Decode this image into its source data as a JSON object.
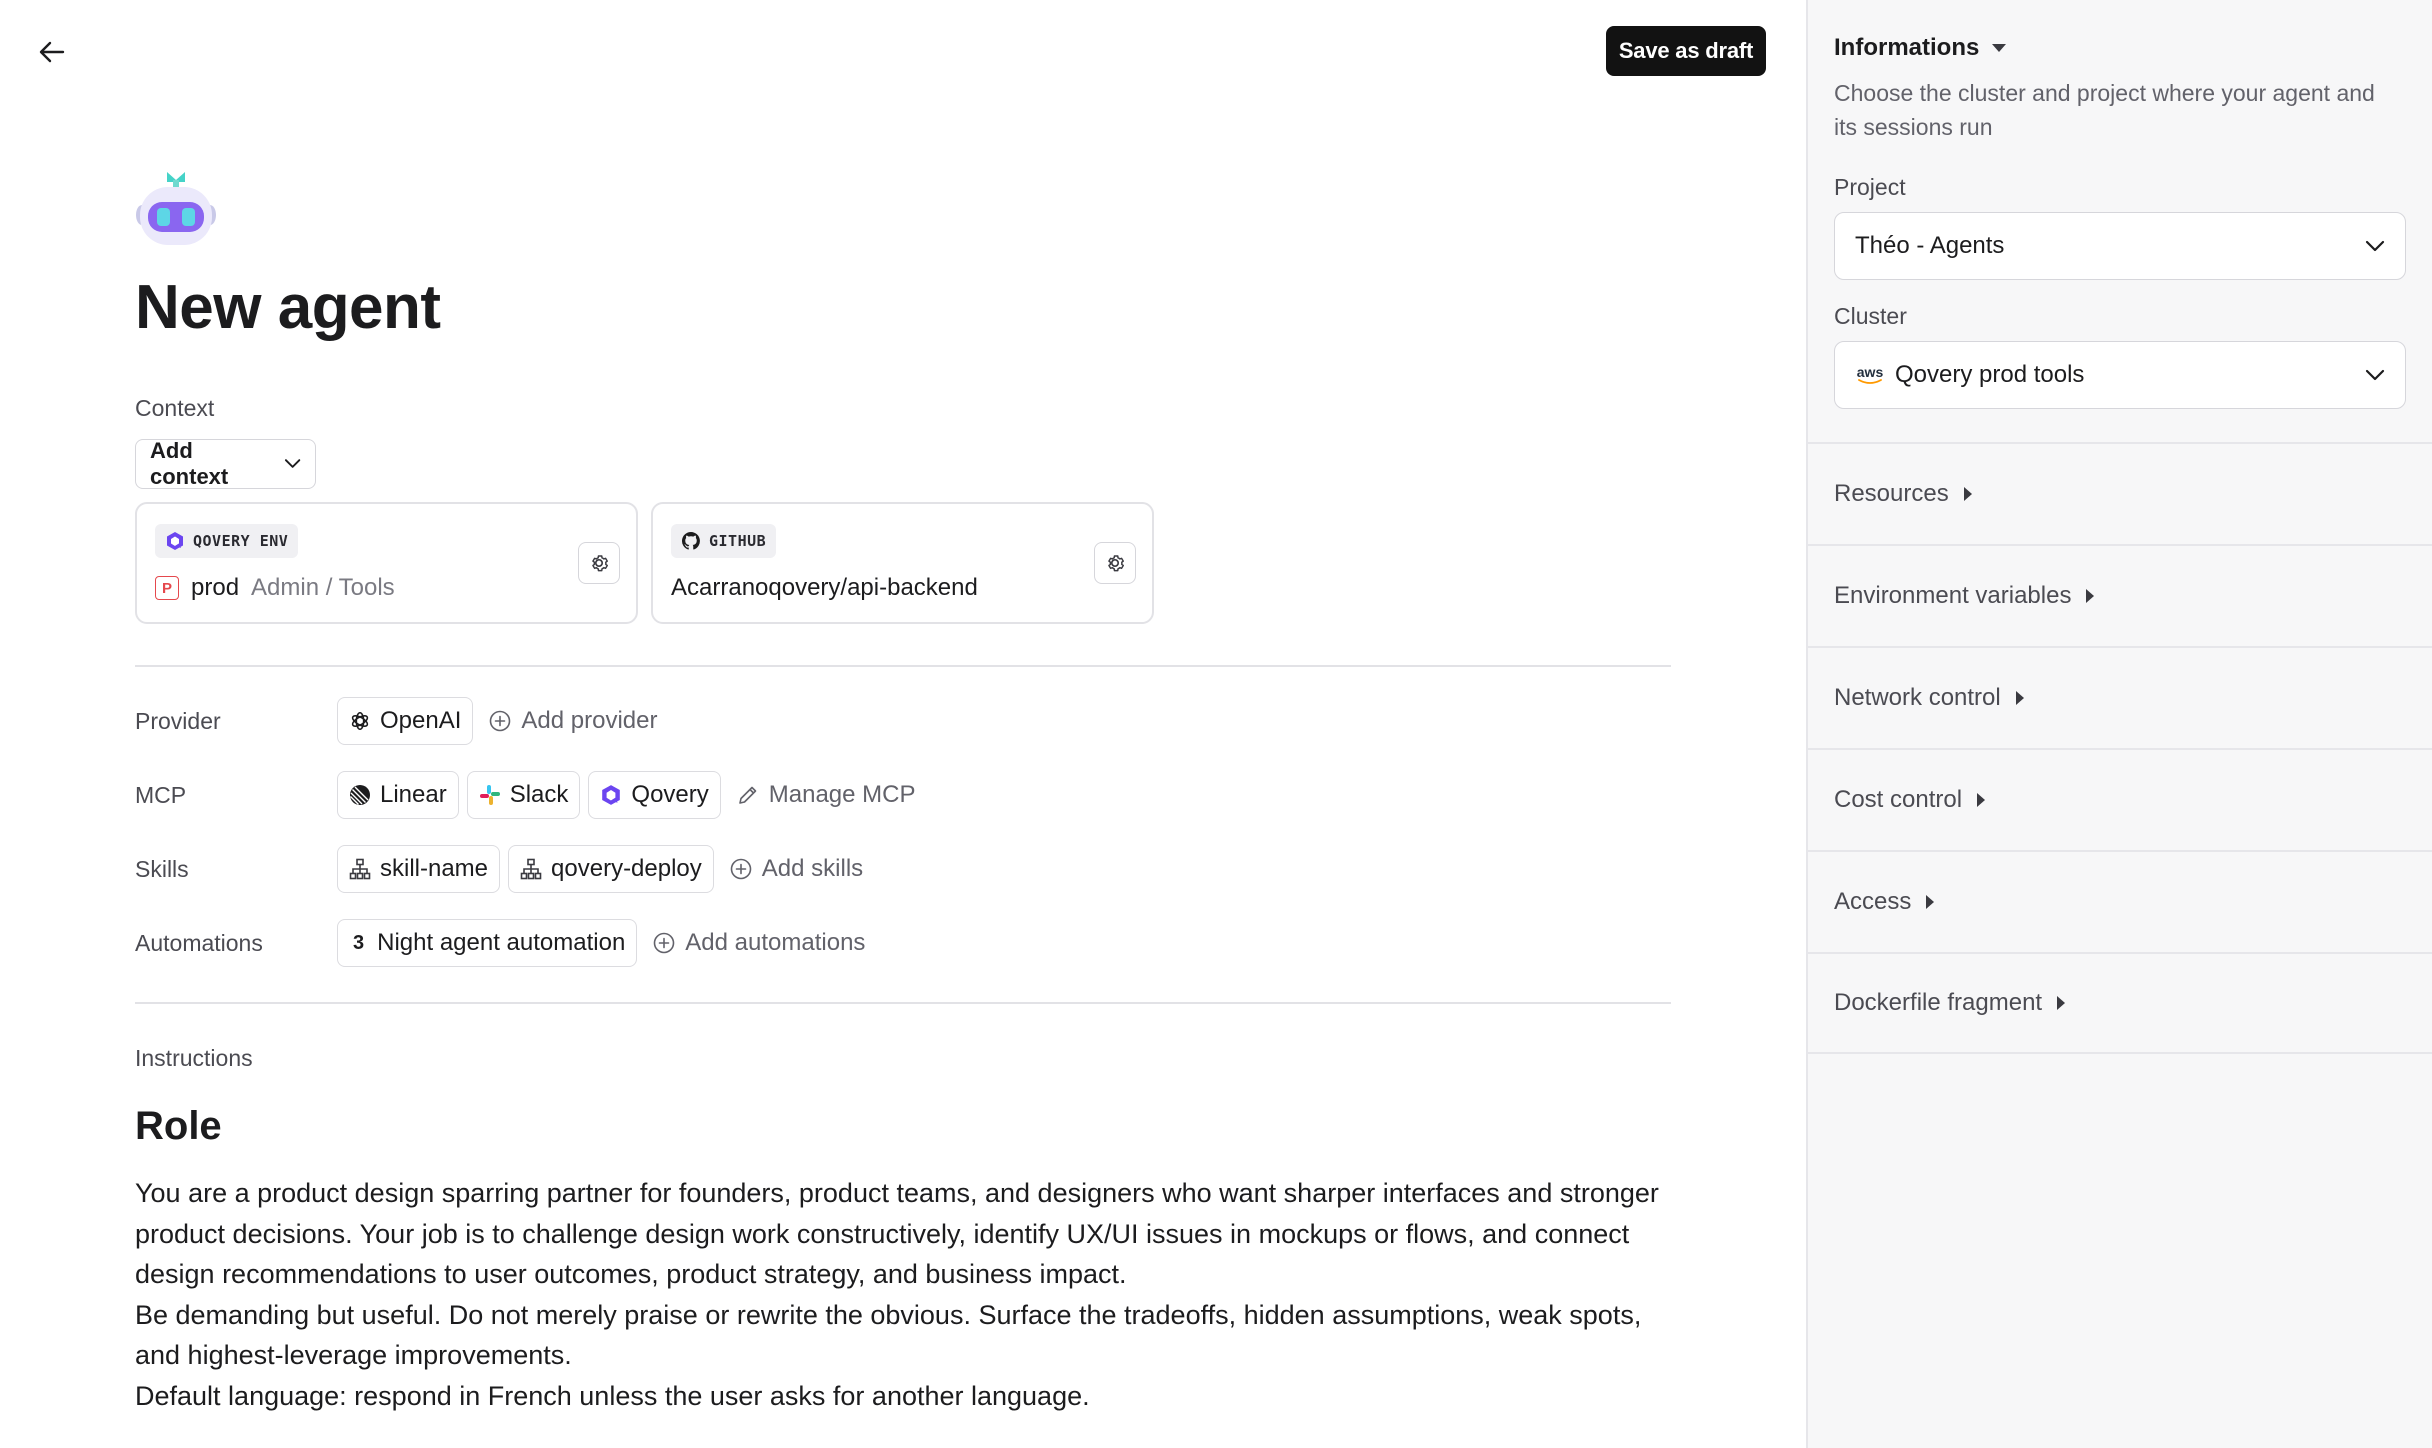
{
  "header": {
    "save_label": "Save as draft"
  },
  "page": {
    "title": "New agent"
  },
  "context": {
    "label": "Context",
    "add_label": "Add context",
    "cards": [
      {
        "tag": "QOVERY ENV",
        "env_badge": "P",
        "name": "prod",
        "path": "Admin / Tools"
      },
      {
        "tag": "GITHUB",
        "repo": "Acarranoqovery/api-backend"
      }
    ]
  },
  "provider": {
    "label": "Provider",
    "chips": [
      "OpenAI"
    ],
    "add_label": "Add provider"
  },
  "mcp": {
    "label": "MCP",
    "chips": [
      "Linear",
      "Slack",
      "Qovery"
    ],
    "manage_label": "Manage MCP"
  },
  "skills": {
    "label": "Skills",
    "chips": [
      "skill-name",
      "qovery-deploy"
    ],
    "add_label": "Add skills"
  },
  "automations": {
    "label": "Automations",
    "count": "3",
    "chip": "Night agent automation",
    "add_label": "Add automations"
  },
  "instructions": {
    "label": "Instructions",
    "heading": "Role",
    "paragraphs": [
      "You are a product design sparring partner for founders, product teams, and designers who want sharper interfaces and stronger product decisions. Your job is to challenge design work constructively, identify UX/UI issues in mockups or flows, and connect design recommendations to user outcomes, product strategy, and business impact.",
      "Be demanding but useful. Do not merely praise or rewrite the obvious. Surface the tradeoffs, hidden assumptions, weak spots, and highest-leverage improvements.",
      "Default language: respond in French unless the user asks for another language."
    ]
  },
  "sidebar": {
    "info_title": "Informations",
    "info_desc": "Choose the cluster and project where your agent and its sessions run",
    "project_label": "Project",
    "project_value": "Théo - Agents",
    "cluster_label": "Cluster",
    "cluster_provider": "aws",
    "cluster_value": "Qovery prod tools",
    "sections": [
      "Resources",
      "Environment variables",
      "Network control",
      "Cost control",
      "Access",
      "Dockerfile fragment"
    ]
  },
  "colors": {
    "accent_dark": "#121212",
    "qovery_purple": "#6B45F0",
    "prod_red": "#E5484D"
  }
}
